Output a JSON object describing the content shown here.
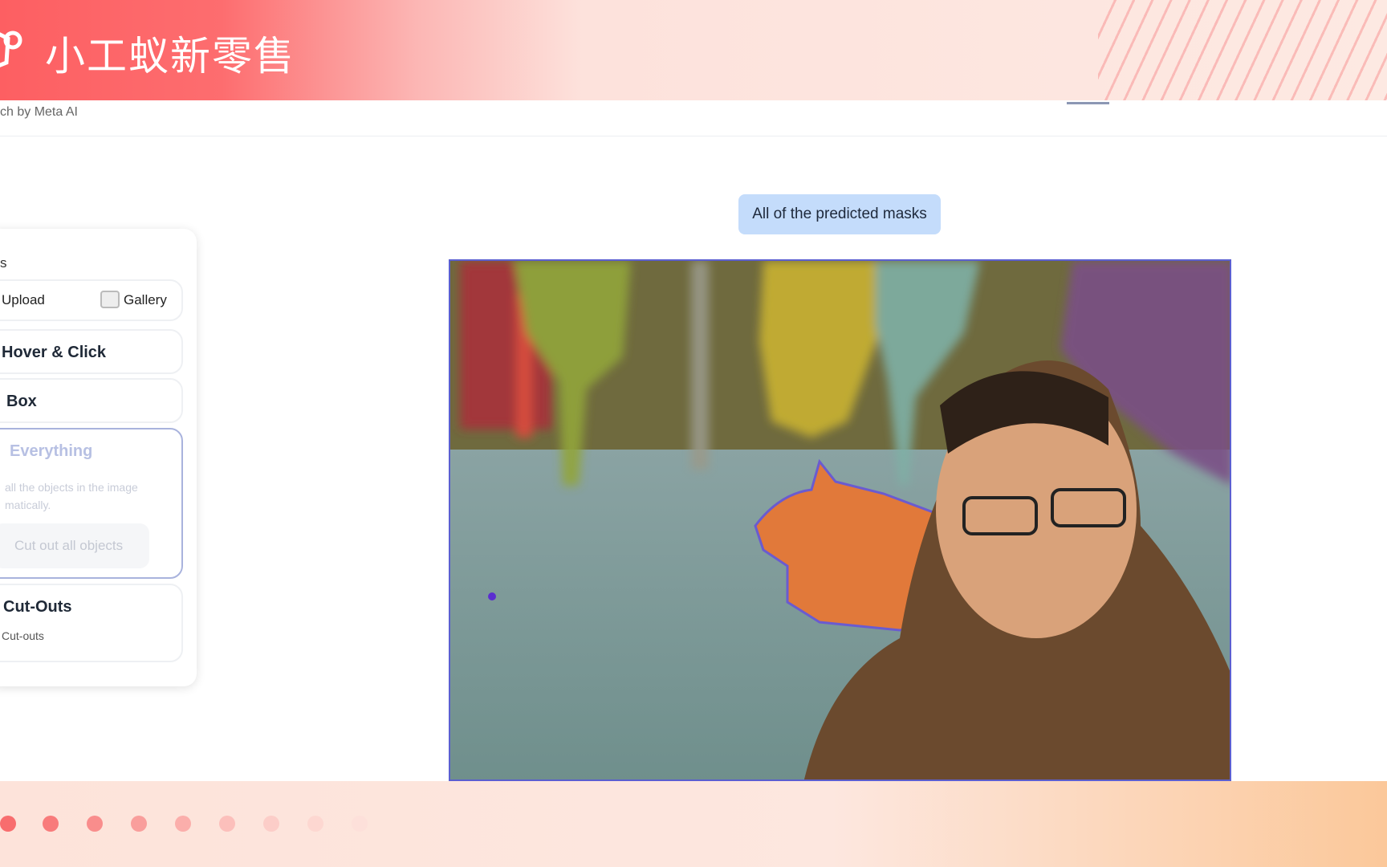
{
  "banner": {
    "brand": "小工蚁新零售",
    "icon": "ant-logo-icon"
  },
  "header": {
    "subtitle": "ch by Meta AI"
  },
  "panel": {
    "heading": "s",
    "upload_label": "Upload",
    "gallery_label": "Gallery",
    "hover_click_label": "Hover & Click",
    "box_label": "Box",
    "everything": {
      "title": "Everything",
      "desc_line1": "all the objects in the image",
      "desc_line2": "matically.",
      "button": "Cut out all objects"
    },
    "cutouts": {
      "title": "Cut-Outs",
      "sub": "Cut-outs"
    }
  },
  "main": {
    "mask_label": "All of the predicted masks"
  },
  "colors": {
    "accent": "#5b5fd0",
    "pill": "#c4dcfb",
    "banner_red": "#fd5f62"
  }
}
